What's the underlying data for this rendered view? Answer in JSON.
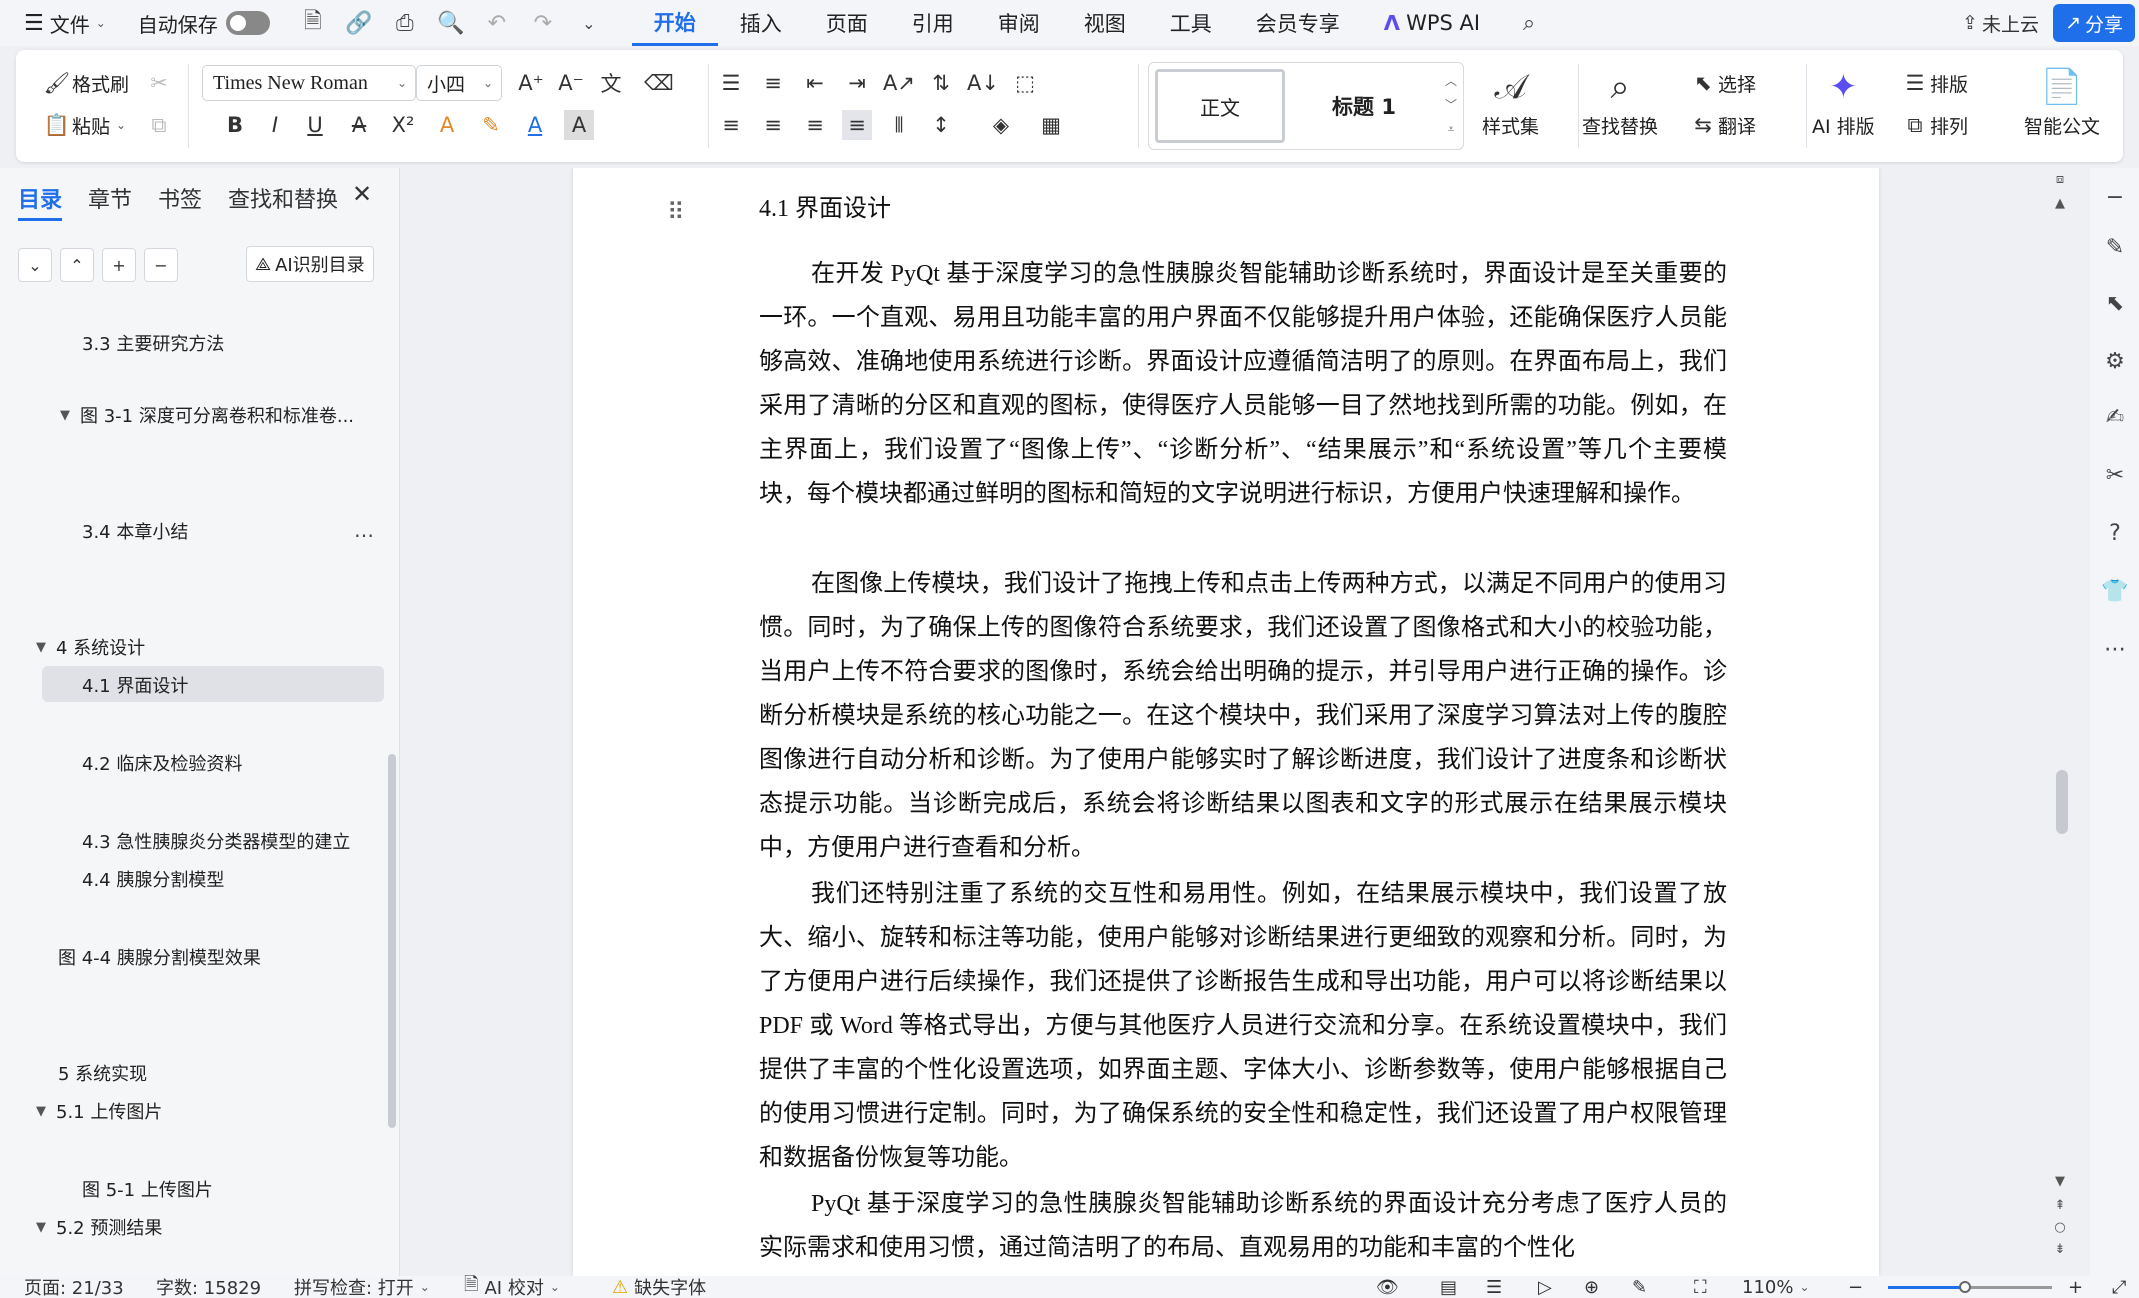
{
  "menubar": {
    "file": "文件",
    "autosave": "自动保存",
    "tabs": [
      "开始",
      "插入",
      "页面",
      "引用",
      "审阅",
      "视图",
      "工具",
      "会员专享",
      "WPS AI"
    ],
    "active_tab": "开始",
    "cloud": "未上云",
    "share": "分享"
  },
  "ribbon": {
    "format_painter": "格式刷",
    "paste": "粘贴",
    "font_name": "Times New Roman",
    "font_size": "小四",
    "style_normal": "正文",
    "style_heading1": "标题 1",
    "styles_gallery": "样式集",
    "find_replace": "查找替换",
    "select": "选择",
    "translate": "翻译",
    "ai_layout": "AI 排版",
    "typeset": "排版",
    "arrange": "排列",
    "smart_doc": "智能公文"
  },
  "nav": {
    "tabs": [
      "目录",
      "章节",
      "书签",
      "查找和替换"
    ],
    "active_tab": "目录",
    "ai_toc": "AI识别目录",
    "items": [
      "3.3 主要研究方法",
      "图 3-1  深度可分离卷积和标准卷...",
      "3.4 本章小结",
      "4  系统设计",
      "4.1  界面设计",
      "4.2 临床及检验资料",
      "4.3 急性胰腺炎分类器模型的建立",
      "4.4  胰腺分割模型",
      "图 4-4  胰腺分割模型效果",
      "5 系统实现",
      "5.1  上传图片",
      "图 5-1  上传图片",
      "5.2  预测结果"
    ]
  },
  "document": {
    "heading": "4.1  界面设计",
    "paragraphs": [
      "在开发 PyQt 基于深度学习的急性胰腺炎智能辅助诊断系统时，界面设计是至关重要的一环。一个直观、易用且功能丰富的用户界面不仅能够提升用户体验，还能确保医疗人员能够高效、准确地使用系统进行诊断。界面设计应遵循简洁明了的原则。在界面布局上，我们采用了清晰的分区和直观的图标，使得医疗人员能够一目了然地找到所需的功能。例如，在主界面上，我们设置了“图像上传”、“诊断分析”、“结果展示”和“系统设置”等几个主要模块，每个模块都通过鲜明的图标和简短的文字说明进行标识，方便用户快速理解和操作。",
      "在图像上传模块，我们设计了拖拽上传和点击上传两种方式，以满足不同用户的使用习惯。同时，为了确保上传的图像符合系统要求，我们还设置了图像格式和大小的校验功能，当用户上传不符合要求的图像时，系统会给出明确的提示，并引导用户进行正确的操作。诊断分析模块是系统的核心功能之一。在这个模块中，我们采用了深度学习算法对上传的腹腔图像进行自动分析和诊断。为了使用户能够实时了解诊断进度，我们设计了进度条和诊断状态提示功能。当诊断完成后，系统会将诊断结果以图表和文字的形式展示在结果展示模块中，方便用户进行查看和分析。",
      "我们还特别注重了系统的交互性和易用性。例如，在结果展示模块中，我们设置了放大、缩小、旋转和标注等功能，使用户能够对诊断结果进行更细致的观察和分析。同时，为了方便用户进行后续操作，我们还提供了诊断报告生成和导出功能，用户可以将诊断结果以 PDF 或 Word 等格式导出，方便与其他医疗人员进行交流和分享。在系统设置模块中，我们提供了丰富的个性化设置选项，如界面主题、字体大小、诊断参数等，使用户能够根据自己的使用习惯进行定制。同时，为了确保系统的安全性和稳定性，我们还设置了用户权限管理和数据备份恢复等功能。",
      "PyQt 基于深度学习的急性胰腺炎智能辅助诊断系统的界面设计充分考虑了医疗人员的实际需求和使用习惯，通过简洁明了的布局、直观易用的功能和丰富的个性化"
    ]
  },
  "status": {
    "page": "页面: 21/33",
    "words": "字数: 15829",
    "spellcheck": "拼写检查: 打开",
    "ai_proof": "AI 校对",
    "missing_font": "缺失字体",
    "zoom": "110%",
    "zoom_level_percent": 47
  },
  "colors": {
    "accent": "#1f6feb",
    "ai_purple": "#5b4ef0",
    "warning": "#e6a100"
  }
}
